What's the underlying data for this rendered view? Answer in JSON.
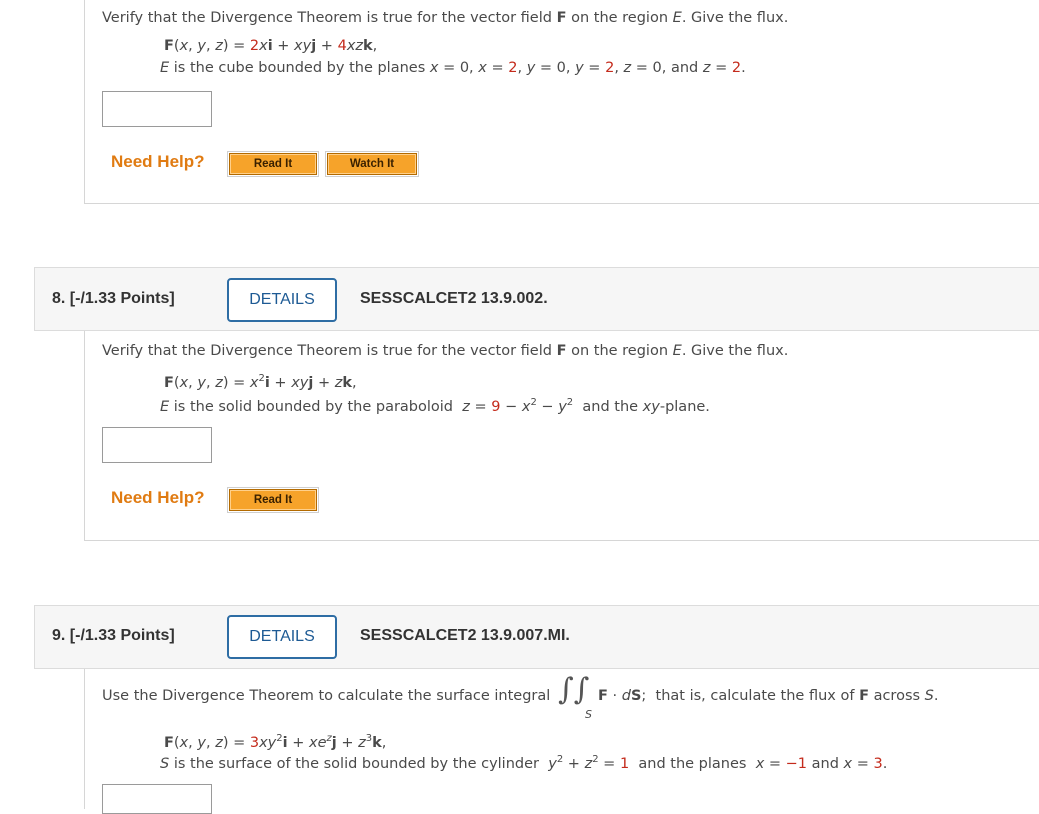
{
  "q7": {
    "intro": "Verify that the Divergence Theorem is true for the vector field F on the region E. Give the flux.",
    "field": "F(x, y, z) = 2xi + xyj + 4xzk,",
    "region": "E is the cube bounded by the planes x = 0, x = 2, y = 0, y = 2, z = 0, and z = 2.",
    "need_help": "Need Help?",
    "read_it": "Read It",
    "watch_it": "Watch It"
  },
  "q8": {
    "points": "8. [-/1.33 Points]",
    "details": "DETAILS",
    "code": "SESSCALCET2 13.9.002.",
    "intro": "Verify that the Divergence Theorem is true for the vector field F on the region E. Give the flux.",
    "field": "F(x, y, z) = x²i + xyj + zk,",
    "region": "E is the solid bounded by the paraboloid z = 9 − x² − y² and the xy-plane.",
    "need_help": "Need Help?",
    "read_it": "Read It"
  },
  "q9": {
    "points": "9. [-/1.33 Points]",
    "details": "DETAILS",
    "code": "SESSCALCET2 13.9.007.MI.",
    "intro": "Use the Divergence Theorem to calculate the surface integral ∬S F · dS; that is, calculate the flux of F across S.",
    "field": "F(x, y, z) = 3xy²i + xe^zj + z³k,",
    "region": "S is the surface of the solid bounded by the cylinder y² + z² = 1 and the planes x = −1 and x = 3."
  },
  "colors": {
    "accent_red": "#c42b1c",
    "help_orange": "#e07b12",
    "details_blue": "#2e6da4"
  }
}
